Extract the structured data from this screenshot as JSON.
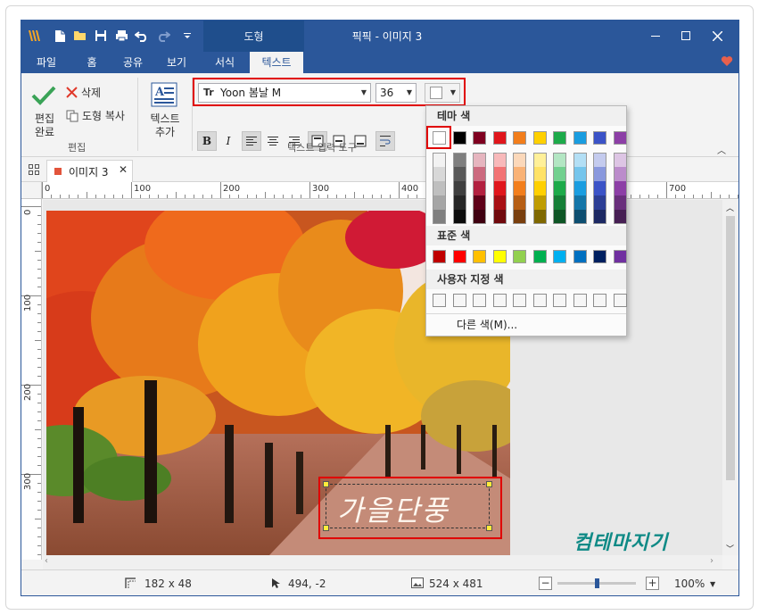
{
  "titlebar": {
    "context_tab": "도형",
    "title": "픽픽 - 이미지 3"
  },
  "tabs": [
    {
      "label": "파일"
    },
    {
      "label": "홈"
    },
    {
      "label": "공유"
    },
    {
      "label": "보기"
    },
    {
      "label": "서식"
    },
    {
      "label": "텍스트"
    }
  ],
  "ribbon": {
    "edit_done_label": "편집\n완료",
    "edit_done_l1": "편집",
    "edit_done_l2": "완료",
    "delete_label": "삭제",
    "copy_shape_label": "도형 복사",
    "edit_group": "편집",
    "add_text_l1": "텍스트",
    "add_text_l2": "추가",
    "font_name": "Yoon 봄날 M",
    "font_size": "36",
    "bold": "B",
    "italic": "I",
    "text_tools_group": "텍스트 입력 도구"
  },
  "doc_tab": {
    "label": "이미지 3"
  },
  "rulers": {
    "h_labels": [
      "0",
      "100",
      "200",
      "300",
      "400",
      "700"
    ],
    "v_labels": [
      "0",
      "100",
      "200",
      "300"
    ]
  },
  "canvas": {
    "text_overlay": "가을단풍",
    "watermark": "컴테마지기"
  },
  "statusbar": {
    "selection_size": "182 x 48",
    "cursor_pos": "494, -2",
    "image_size": "524 x 481",
    "zoom": "100%",
    "zoom_level": 0.5
  },
  "color_popup": {
    "theme_title": "테마 색",
    "standard_title": "표준 색",
    "custom_title": "사용자 지정 색",
    "more_colors": "다른 색(M)...",
    "theme_top": [
      "#ffffff",
      "#000000",
      "#7f0020",
      "#e0161c",
      "#f27e1c",
      "#ffd000",
      "#1daa4a",
      "#1a9de0",
      "#3b53c7",
      "#8c3fa6"
    ],
    "theme_shades": [
      [
        "#f2f2f2",
        "#d8d8d8",
        "#bfbfbf",
        "#a5a5a5",
        "#7f7f7f"
      ],
      [
        "#7f7f7f",
        "#595959",
        "#3f3f3f",
        "#262626",
        "#0c0c0c"
      ],
      [
        "#e6b5bf",
        "#cc6a7f",
        "#b2203f",
        "#5f0018",
        "#3f0010"
      ],
      [
        "#f8b9ba",
        "#f27374",
        "#e0161c",
        "#a80f14",
        "#70090d"
      ],
      [
        "#fbd8ba",
        "#f9b276",
        "#f27e1c",
        "#b65e14",
        "#793f0e"
      ],
      [
        "#fff099",
        "#ffe266",
        "#ffd000",
        "#bf9c00",
        "#7f6800"
      ],
      [
        "#b3e6c3",
        "#72d08f",
        "#1daa4a",
        "#157f37",
        "#0e5525"
      ],
      [
        "#b3dff5",
        "#75c5ec",
        "#1a9de0",
        "#1375a8",
        "#0d4e70"
      ],
      [
        "#c4cbee",
        "#8998dd",
        "#3b53c7",
        "#2c3e95",
        "#1d2963"
      ],
      [
        "#ddc5e4",
        "#bb8ccb",
        "#8c3fa6",
        "#692f7c",
        "#461f53"
      ]
    ],
    "standard": [
      "#c00000",
      "#ff0000",
      "#ffc000",
      "#ffff00",
      "#92d050",
      "#00b050",
      "#00b0f0",
      "#0070c0",
      "#002060",
      "#7030a0"
    ]
  }
}
